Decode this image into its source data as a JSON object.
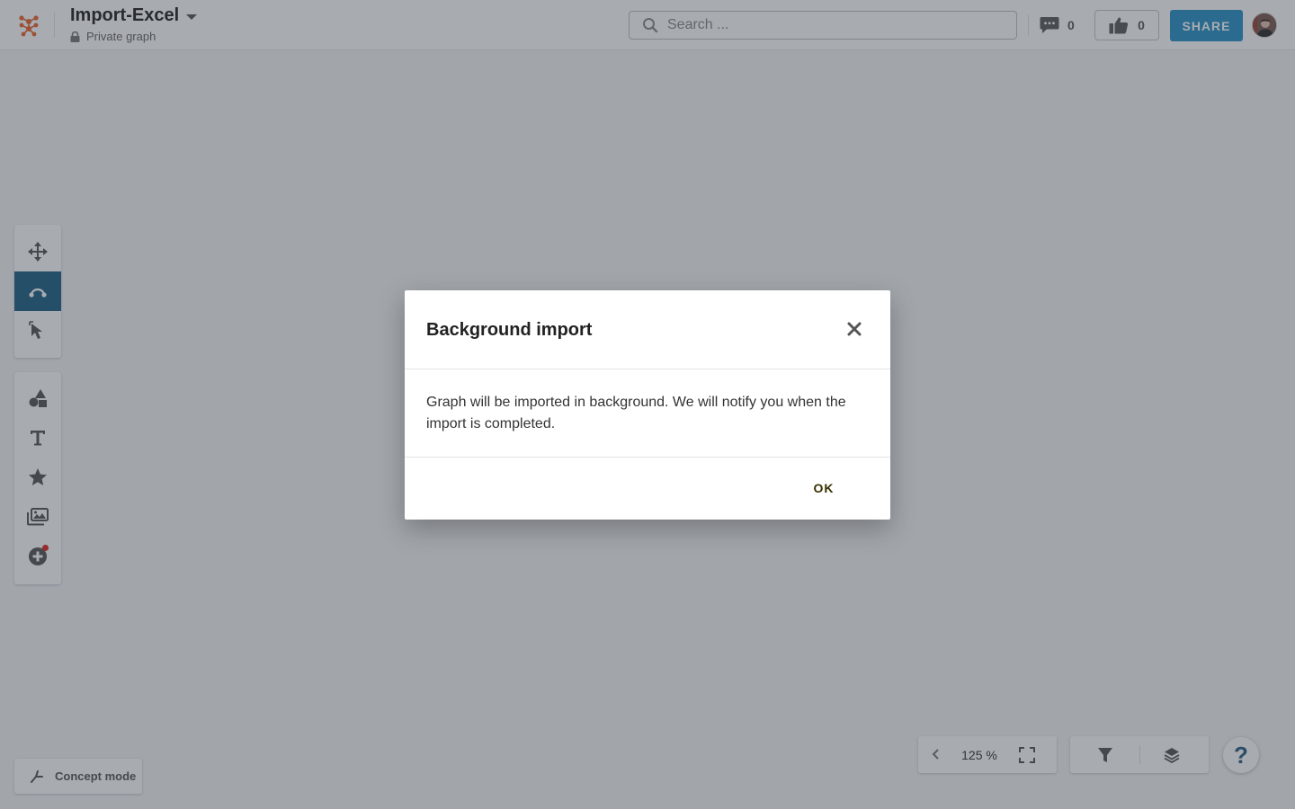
{
  "header": {
    "title": "Import-Excel",
    "visibility_label": "Private graph",
    "search_placeholder": "Search ...",
    "comments_count": "0",
    "likes_count": "0",
    "share_label": "SHARE"
  },
  "left_toolbar": {
    "navigation_tools": [
      "move-icon",
      "edge-draw-icon",
      "select-pointer-icon"
    ],
    "active_tool": "edge-draw-icon",
    "content_tools": [
      "shapes-icon",
      "text-icon",
      "star-icon",
      "images-icon",
      "add-plugin-icon"
    ]
  },
  "bottom": {
    "concept_mode_label": "Concept mode",
    "zoom_level": "125 %",
    "help_label": "?"
  },
  "modal": {
    "title": "Background import",
    "message": "Graph will be imported in background. We will notify you when the import is completed.",
    "ok_label": "OK"
  },
  "colors": {
    "share_button": "#2691c7",
    "active_tool": "#1e5f86",
    "logo_orange": "#e8652f",
    "notification_dot": "#e0261f",
    "help_icon": "#2a5d84"
  }
}
